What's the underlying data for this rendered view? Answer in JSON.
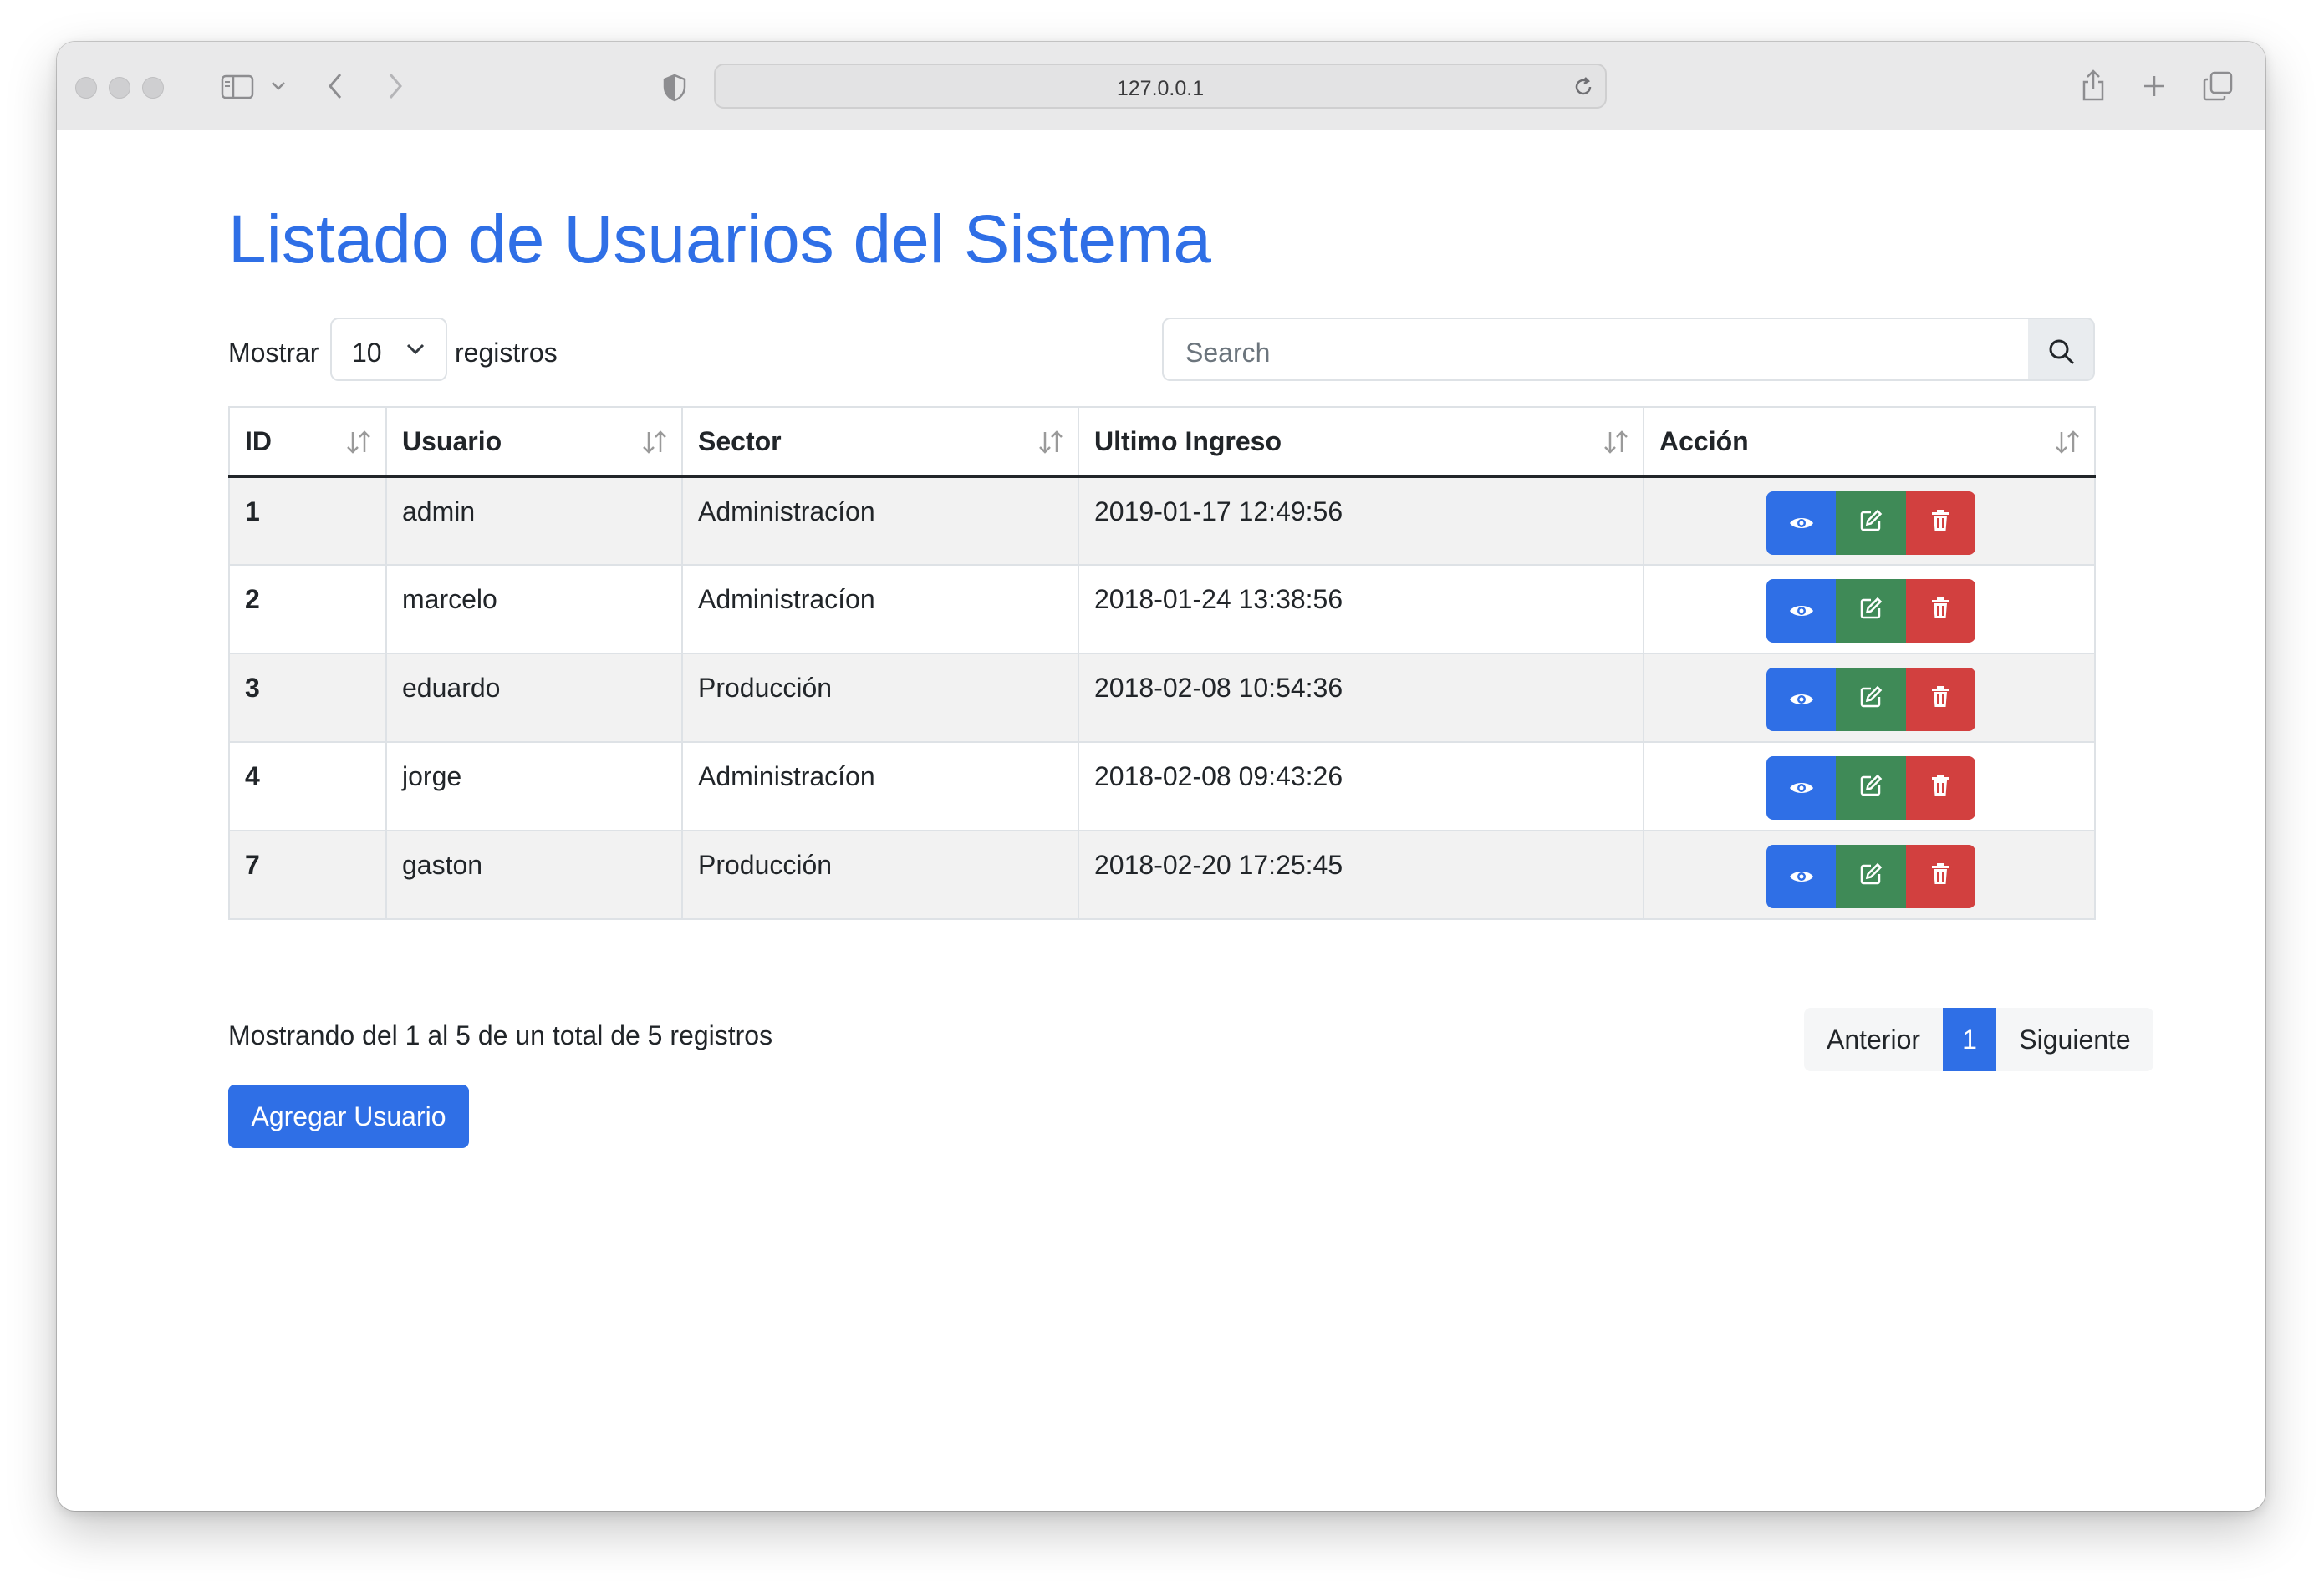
{
  "browser": {
    "url": "127.0.0.1"
  },
  "page": {
    "title": "Listado de Usuarios del Sistema"
  },
  "length_control": {
    "prefix": "Mostrar",
    "value": "10",
    "suffix": "registros"
  },
  "search": {
    "placeholder": "Search"
  },
  "table": {
    "columns": [
      "ID",
      "Usuario",
      "Sector",
      "Ultimo Ingreso",
      "Acción"
    ],
    "rows": [
      {
        "id": "1",
        "usuario": "admin",
        "sector": "Administracíon",
        "ultimo": "2019-01-17 12:49:56"
      },
      {
        "id": "2",
        "usuario": "marcelo",
        "sector": "Administracíon",
        "ultimo": "2018-01-24 13:38:56"
      },
      {
        "id": "3",
        "usuario": "eduardo",
        "sector": "Producción",
        "ultimo": "2018-02-08 10:54:36"
      },
      {
        "id": "4",
        "usuario": "jorge",
        "sector": "Administracíon",
        "ultimo": "2018-02-08 09:43:26"
      },
      {
        "id": "7",
        "usuario": "gaston",
        "sector": "Producción",
        "ultimo": "2018-02-20 17:25:45"
      }
    ],
    "action_icons": [
      "eye-icon",
      "edit-icon",
      "trash-icon"
    ]
  },
  "footer": {
    "info": "Mostrando del 1 al 5 de un total de 5 registros",
    "pagination": {
      "prev": "Anterior",
      "current": "1",
      "next": "Siguiente"
    },
    "add_button": "Agregar Usuario"
  },
  "colors": {
    "primary": "#2f6fe6",
    "success": "#3f8a57",
    "danger": "#d2403f"
  }
}
